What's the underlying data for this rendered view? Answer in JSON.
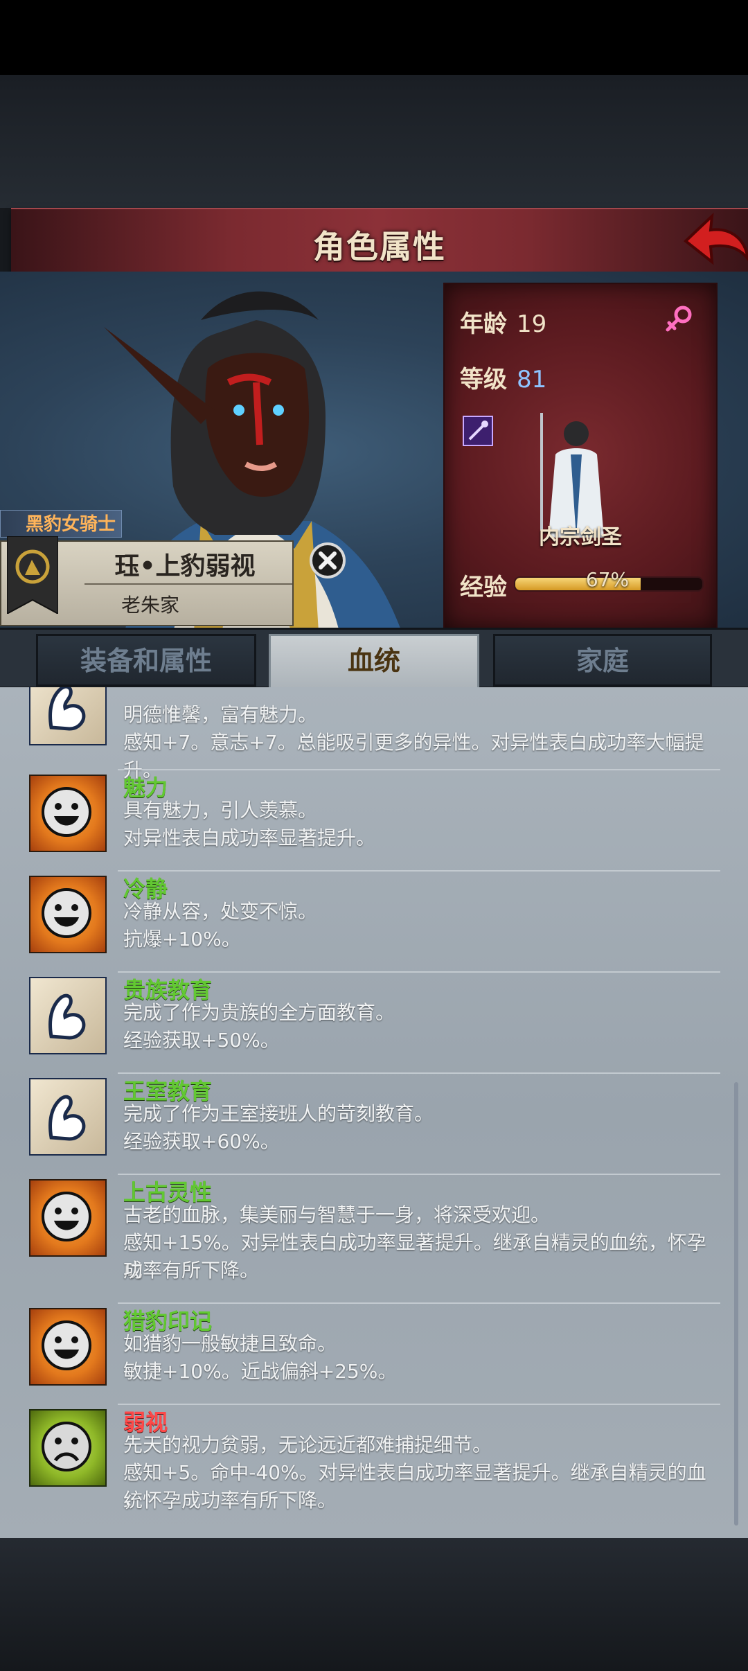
{
  "header": {
    "title": "角色属性"
  },
  "stats": {
    "age_label": "年龄",
    "age_value": "19",
    "level_label": "等级",
    "level_value": "81",
    "class_name": "内宗剑圣",
    "exp_label": "经验",
    "exp_text": "67%",
    "exp_fraction": 0.67
  },
  "character": {
    "title": "黑豹女骑士",
    "name": "珏•上豹弱视",
    "family": "老朱家"
  },
  "tabs": [
    {
      "label": "装备和属性",
      "active": false
    },
    {
      "label": "血统",
      "active": true
    },
    {
      "label": "家庭",
      "active": false
    }
  ],
  "traits": [
    {
      "icon": "arm-icon",
      "name": "",
      "tone": "good",
      "lines": [
        "明德惟馨，富有魅力。",
        "感知+7。意志+7。总能吸引更多的异性。对异性表白成功率大幅提升。"
      ]
    },
    {
      "icon": "smile-icon",
      "name": "魅力",
      "tone": "good",
      "lines": [
        "具有魅力，引人羡慕。",
        "对异性表白成功率显著提升。"
      ]
    },
    {
      "icon": "smile-icon",
      "name": "冷静",
      "tone": "good",
      "lines": [
        "冷静从容，处变不惊。",
        "抗爆+10%。"
      ]
    },
    {
      "icon": "arm-icon",
      "name": "贵族教育",
      "tone": "good",
      "lines": [
        "完成了作为贵族的全方面教育。",
        "经验获取+50%。"
      ]
    },
    {
      "icon": "arm-icon",
      "name": "王室教育",
      "tone": "good",
      "lines": [
        "完成了作为王室接班人的苛刻教育。",
        "经验获取+60%。"
      ]
    },
    {
      "icon": "smile-icon",
      "name": "上古灵性",
      "tone": "good",
      "lines": [
        "古老的血脉，集美丽与智慧于一身，将深受欢迎。",
        "感知+15%。对异性表白成功率显著提升。继承自精灵的血统，怀孕成",
        "功率有所下降。"
      ]
    },
    {
      "icon": "smile-icon",
      "name": "猎豹印记",
      "tone": "good",
      "lines": [
        "如猎豹一般敏捷且致命。",
        "敏捷+10%。近战偏斜+25%。"
      ]
    },
    {
      "icon": "sad-icon",
      "name": "弱视",
      "tone": "bad",
      "lines": [
        "先天的视力贫弱，无论远近都难捕捉细节。",
        "感知+5。命中-40%。对异性表白成功率显著提升。继承自精灵的血统",
        "，怀孕成功率有所下降。"
      ]
    }
  ],
  "colors": {
    "good": "#62c832",
    "bad": "#ff4848",
    "level_value": "#8ec4ff",
    "title_tag": "#ffb45a"
  }
}
